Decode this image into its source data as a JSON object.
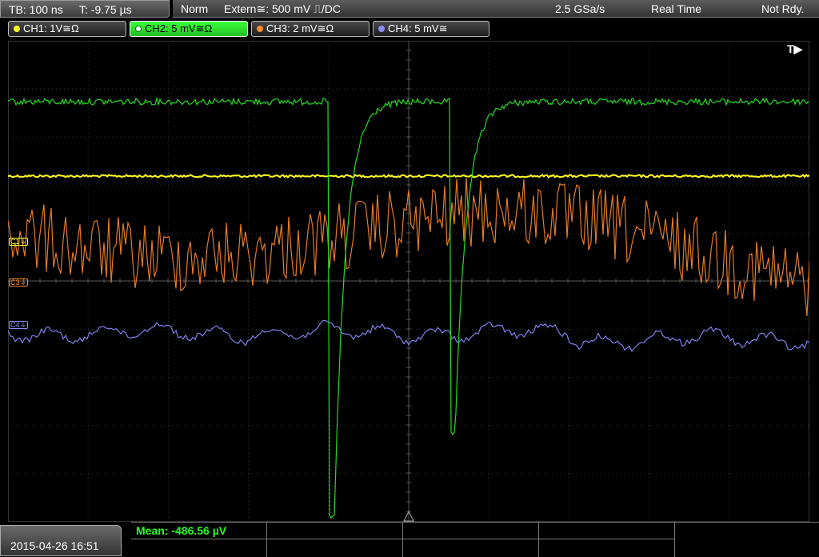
{
  "header": {
    "timebase": "TB: 100 ns",
    "trigger_time": "T: -9.75 µs",
    "trigger_mode": "Norm",
    "trigger_source": "Extern≅: 500 mV ⎍/DC",
    "sample_rate": "2.5 GSa/s",
    "acq_mode": "Real Time",
    "status": "Not Rdy."
  },
  "channels": [
    {
      "label": "CH1: 1V≅Ω",
      "color": "#ffff22"
    },
    {
      "label": "CH2: 5 mV≅Ω",
      "color": "#22ff22"
    },
    {
      "label": "CH3: 2 mV≅Ω",
      "color": "#ff8c2a"
    },
    {
      "label": "CH4: 5 mV≅",
      "color": "#8c8cff"
    }
  ],
  "screen": {
    "trigger_marker": "T▶",
    "offset_labels": {
      "c1": "C1⏚",
      "c3": "C3⏚",
      "c4": "C4⏚"
    }
  },
  "measurement": {
    "mean": "Mean: -486.56 µV"
  },
  "footer": {
    "datetime": "2015-04-26 16:51"
  }
}
